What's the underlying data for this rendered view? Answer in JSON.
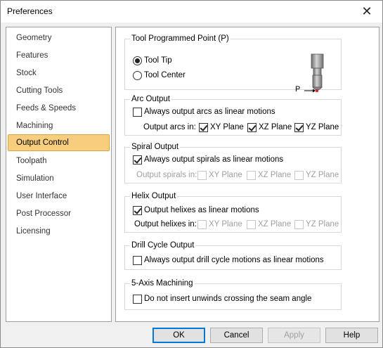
{
  "window": {
    "title": "Preferences"
  },
  "nav": {
    "items": [
      {
        "label": "Geometry"
      },
      {
        "label": "Features"
      },
      {
        "label": "Stock"
      },
      {
        "label": "Cutting Tools"
      },
      {
        "label": "Feeds & Speeds"
      },
      {
        "label": "Machining"
      },
      {
        "label": "Output Control"
      },
      {
        "label": "Toolpath"
      },
      {
        "label": "Simulation"
      },
      {
        "label": "User Interface"
      },
      {
        "label": "Post Processor"
      },
      {
        "label": "Licensing"
      }
    ],
    "selected": "Output Control"
  },
  "tool_point": {
    "title": "Tool Programmed Point (P)",
    "options": [
      {
        "label": "Tool Tip",
        "selected": true
      },
      {
        "label": "Tool Center",
        "selected": false
      }
    ],
    "graphic_label": "P"
  },
  "arc": {
    "title": "Arc Output",
    "main_label": "Always output arcs as linear motions",
    "main_checked": false,
    "planes_label": "Output arcs in:",
    "planes": [
      {
        "label": "XY Plane",
        "checked": true,
        "enabled": true
      },
      {
        "label": "XZ Plane",
        "checked": true,
        "enabled": true
      },
      {
        "label": "YZ Plane",
        "checked": true,
        "enabled": true
      }
    ]
  },
  "spiral": {
    "title": "Spiral Output",
    "main_label": "Always output spirals as linear motions",
    "main_checked": true,
    "planes_label": "Output spirals in:",
    "planes": [
      {
        "label": "XY Plane",
        "checked": false,
        "enabled": false
      },
      {
        "label": "XZ Plane",
        "checked": false,
        "enabled": false
      },
      {
        "label": "YZ Plane",
        "checked": false,
        "enabled": false
      }
    ]
  },
  "helix": {
    "title": "Helix Output",
    "main_label": "Output helixes as linear motions",
    "main_checked": true,
    "planes_label": "Output helixes in:",
    "planes": [
      {
        "label": "XY Plane",
        "checked": false,
        "enabled": false
      },
      {
        "label": "XZ Plane",
        "checked": false,
        "enabled": false
      },
      {
        "label": "YZ Plane",
        "checked": false,
        "enabled": false
      }
    ]
  },
  "drill": {
    "title": "Drill Cycle Output",
    "main_label": "Always output drill cycle motions as linear motions",
    "main_checked": false
  },
  "five_axis": {
    "title": "5-Axis Machining",
    "main_label": "Do not insert unwinds crossing the seam angle",
    "main_checked": false
  },
  "buttons": {
    "ok": "OK",
    "cancel": "Cancel",
    "apply": "Apply",
    "help": "Help"
  },
  "icons": {
    "close": "close-icon",
    "tool": "end-mill-icon"
  },
  "colors": {
    "selection_fill": "#f7ce7d",
    "selection_border": "#d9a33e",
    "default_button_border": "#0078d7",
    "tool_point_marker": "#e02020"
  }
}
